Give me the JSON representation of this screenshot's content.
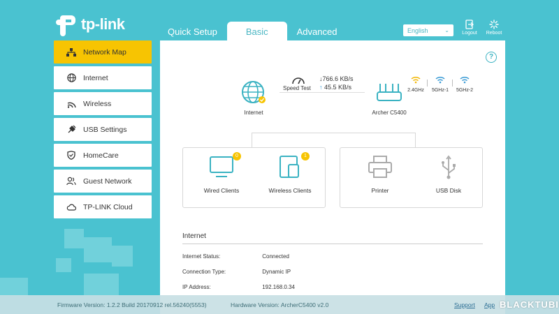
{
  "brand": {
    "logo_text": "tp-link"
  },
  "tabs": [
    {
      "label": "Quick Setup"
    },
    {
      "label": "Basic"
    },
    {
      "label": "Advanced"
    }
  ],
  "language": {
    "selected": "English"
  },
  "top_actions": {
    "logout": "Logout",
    "reboot": "Reboot"
  },
  "sidebar": {
    "items": [
      {
        "label": "Network Map",
        "icon": "network-map-icon"
      },
      {
        "label": "Internet",
        "icon": "globe-icon"
      },
      {
        "label": "Wireless",
        "icon": "wifi-icon"
      },
      {
        "label": "USB Settings",
        "icon": "usb-plug-icon"
      },
      {
        "label": "HomeCare",
        "icon": "shield-icon"
      },
      {
        "label": "Guest Network",
        "icon": "guest-users-icon"
      },
      {
        "label": "TP-LINK Cloud",
        "icon": "cloud-icon"
      }
    ]
  },
  "network_map": {
    "internet_label": "Internet",
    "speed_test_label": "Speed Test",
    "download": "766.6 KB/s",
    "upload": "45.5 KB/s",
    "router_label": "Archer C5400",
    "bands": [
      "2.4GHz",
      "5GHz-1",
      "5GHz-2"
    ],
    "band_colors": [
      "#f2b705",
      "#3a9bd5",
      "#3a9bd5"
    ],
    "wired_clients": {
      "label": "Wired Clients",
      "count": "0"
    },
    "wireless_clients": {
      "label": "Wireless Clients",
      "count": "1"
    },
    "printer": {
      "label": "Printer"
    },
    "usb_disk": {
      "label": "USB Disk"
    }
  },
  "internet_info": {
    "title": "Internet",
    "rows": [
      {
        "key": "Internet Status:",
        "value": "Connected"
      },
      {
        "key": "Connection Type:",
        "value": "Dynamic IP"
      },
      {
        "key": "IP Address:",
        "value": "192.168.0.34"
      }
    ]
  },
  "footer": {
    "firmware": "Firmware Version: 1.2.2 Build 20170912 rel.56240(5553)",
    "hardware": "Hardware Version: ArcherC5400 v2.0",
    "support": "Support",
    "app": "App",
    "watermark": "BLACKTUBI"
  },
  "colors": {
    "background": "#4ac2d0",
    "accent": "#3ab2c2",
    "active_nav": "#f7c402"
  }
}
